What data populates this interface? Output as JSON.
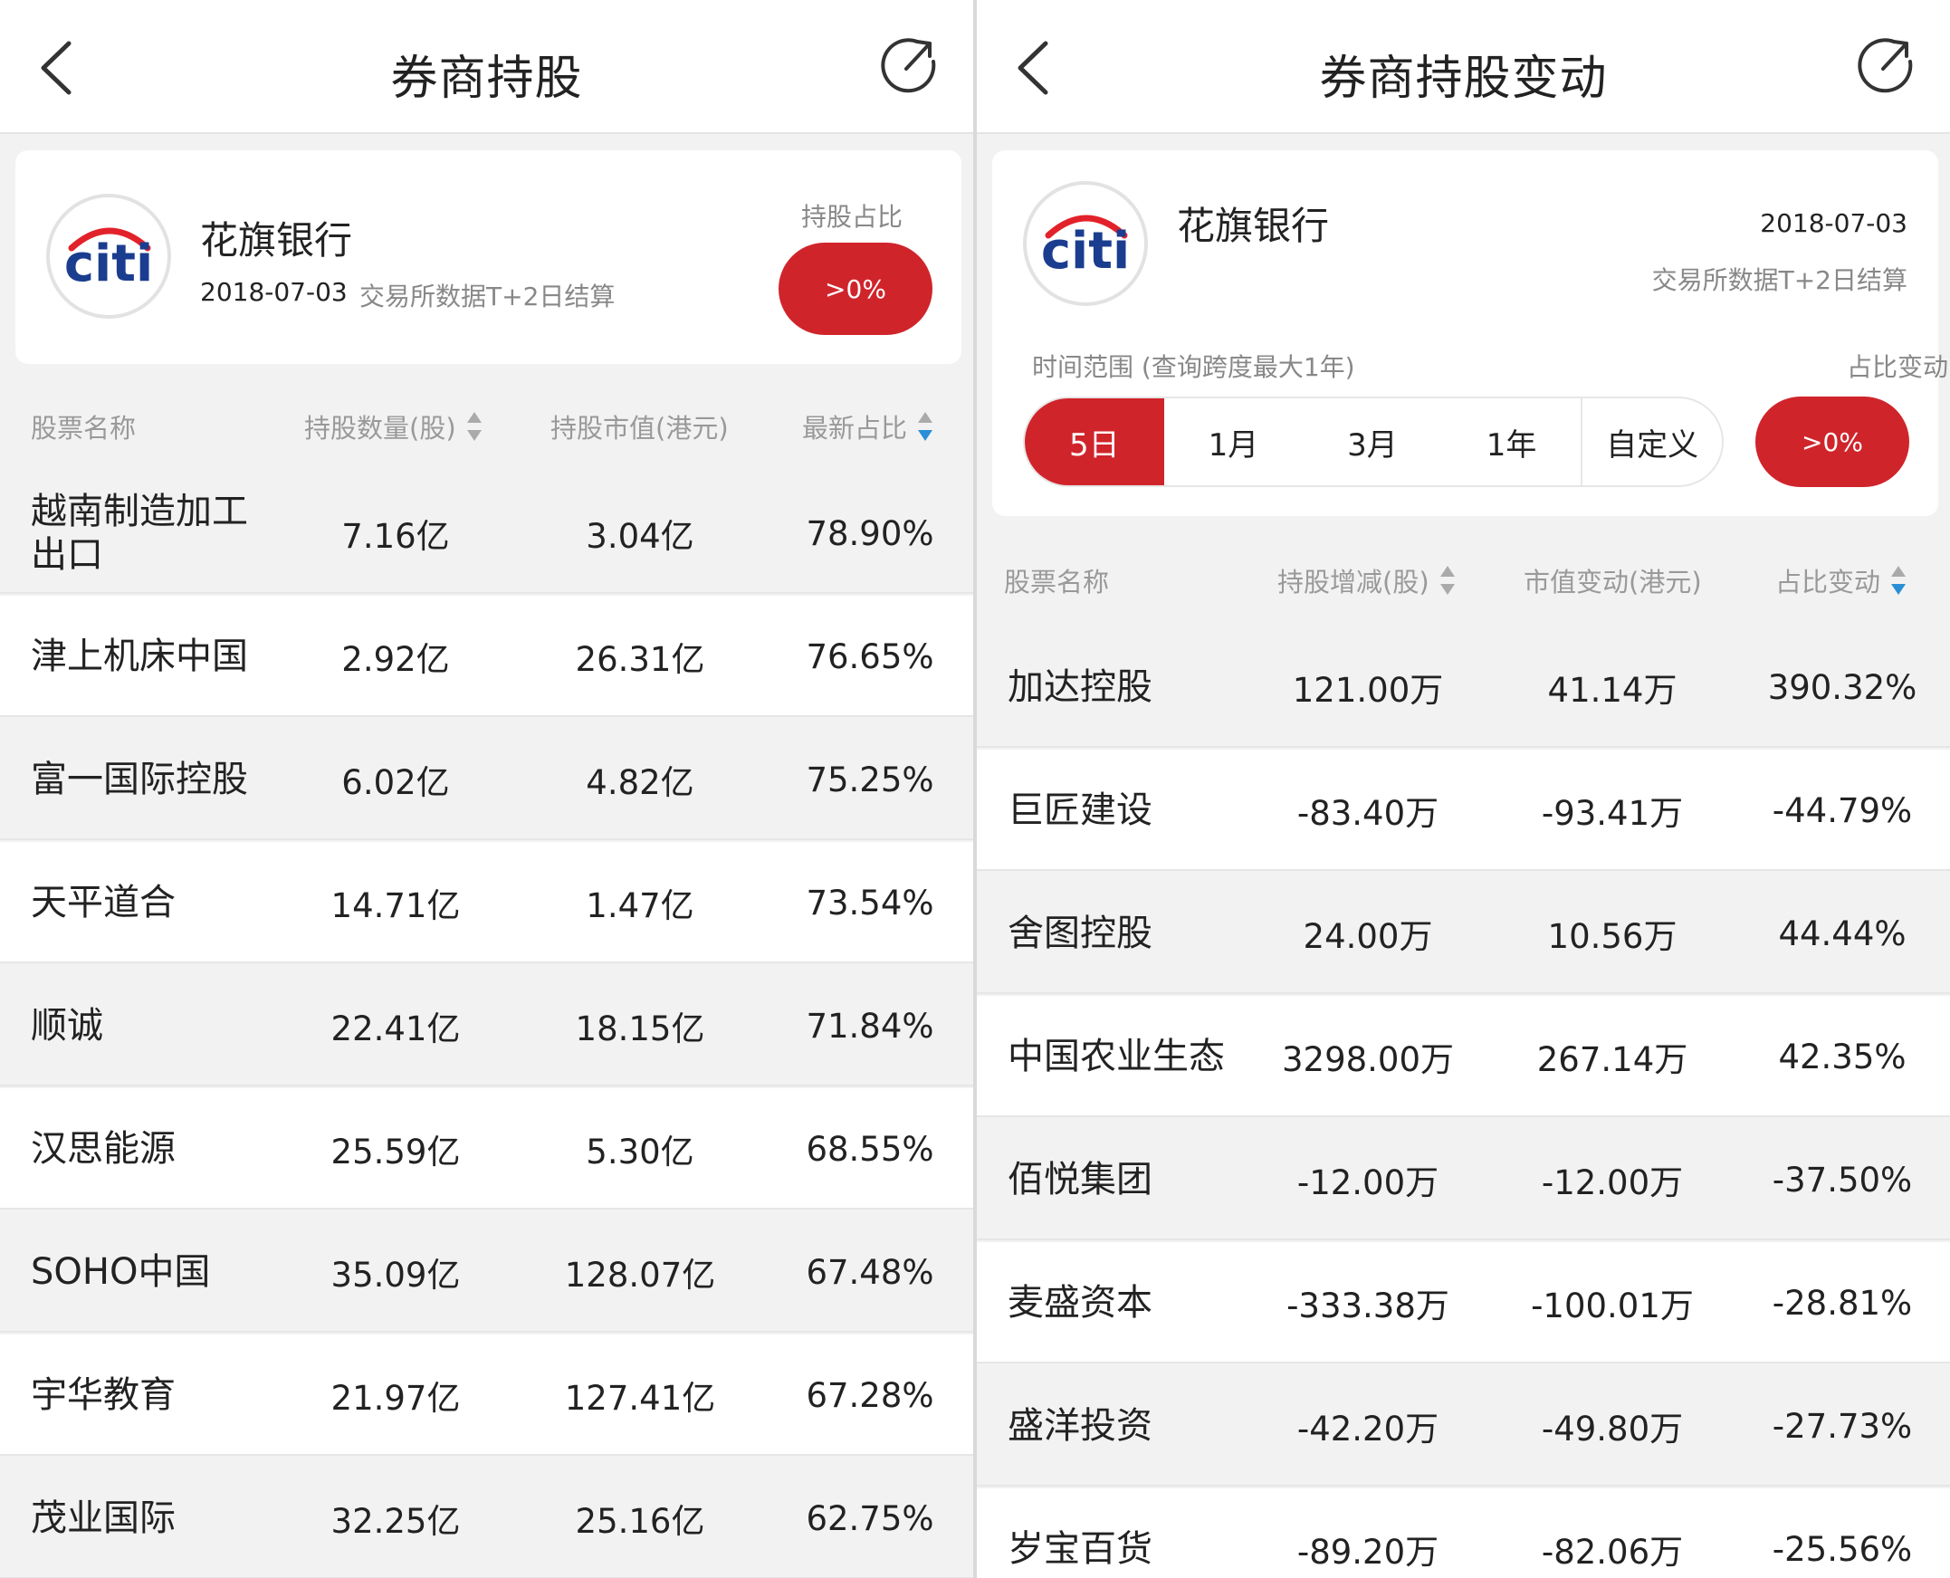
{
  "colors": {
    "accent": "#d0242b",
    "sort_active": "#2a8fd6",
    "citi_blue": "#1b3d8f",
    "citi_red": "#e2222a"
  },
  "left": {
    "title": "券商持股",
    "broker": {
      "name": "花旗银行",
      "date": "2018-07-03",
      "note": "交易所数据T+2日结算",
      "ratio_label": "持股占比",
      "ratio_button": ">0%",
      "logo_text": "citi"
    },
    "columns": [
      "股票名称",
      "持股数量(股)",
      "持股市值(港元)",
      "最新占比"
    ],
    "rows": [
      [
        "越南制造加工出口",
        "7.16亿",
        "3.04亿",
        "78.90%"
      ],
      [
        "津上机床中国",
        "2.92亿",
        "26.31亿",
        "76.65%"
      ],
      [
        "富一国际控股",
        "6.02亿",
        "4.82亿",
        "75.25%"
      ],
      [
        "天平道合",
        "14.71亿",
        "1.47亿",
        "73.54%"
      ],
      [
        "顺诚",
        "22.41亿",
        "18.15亿",
        "71.84%"
      ],
      [
        "汉思能源",
        "25.59亿",
        "5.30亿",
        "68.55%"
      ],
      [
        "SOHO中国",
        "35.09亿",
        "128.07亿",
        "67.48%"
      ],
      [
        "宇华教育",
        "21.97亿",
        "127.41亿",
        "67.28%"
      ],
      [
        "茂业国际",
        "32.25亿",
        "25.16亿",
        "62.75%"
      ]
    ]
  },
  "right": {
    "title": "券商持股变动",
    "broker": {
      "name": "花旗银行",
      "date": "2018-07-03",
      "note": "交易所数据T+2日结算",
      "logo_text": "citi"
    },
    "time_range_label": "时间范围 (查询跨度最大1年)",
    "ratio_change_label": "占比变动",
    "ratio_button": ">0%",
    "segments": [
      "5日",
      "1月",
      "3月",
      "1年",
      "自定义"
    ],
    "columns": [
      "股票名称",
      "持股增减(股)",
      "市值变动(港元)",
      "占比变动"
    ],
    "rows": [
      [
        "加达控股",
        "121.00万",
        "41.14万",
        "390.32%"
      ],
      [
        "巨匠建设",
        "-83.40万",
        "-93.41万",
        "-44.79%"
      ],
      [
        "舍图控股",
        "24.00万",
        "10.56万",
        "44.44%"
      ],
      [
        "中国农业生态",
        "3298.00万",
        "267.14万",
        "42.35%"
      ],
      [
        "佰悦集团",
        "-12.00万",
        "-12.00万",
        "-37.50%"
      ],
      [
        "麦盛资本",
        "-333.38万",
        "-100.01万",
        "-28.81%"
      ],
      [
        "盛洋投资",
        "-42.20万",
        "-49.80万",
        "-27.73%"
      ],
      [
        "岁宝百货",
        "-89.20万",
        "-82.06万",
        "-25.56%"
      ]
    ]
  }
}
